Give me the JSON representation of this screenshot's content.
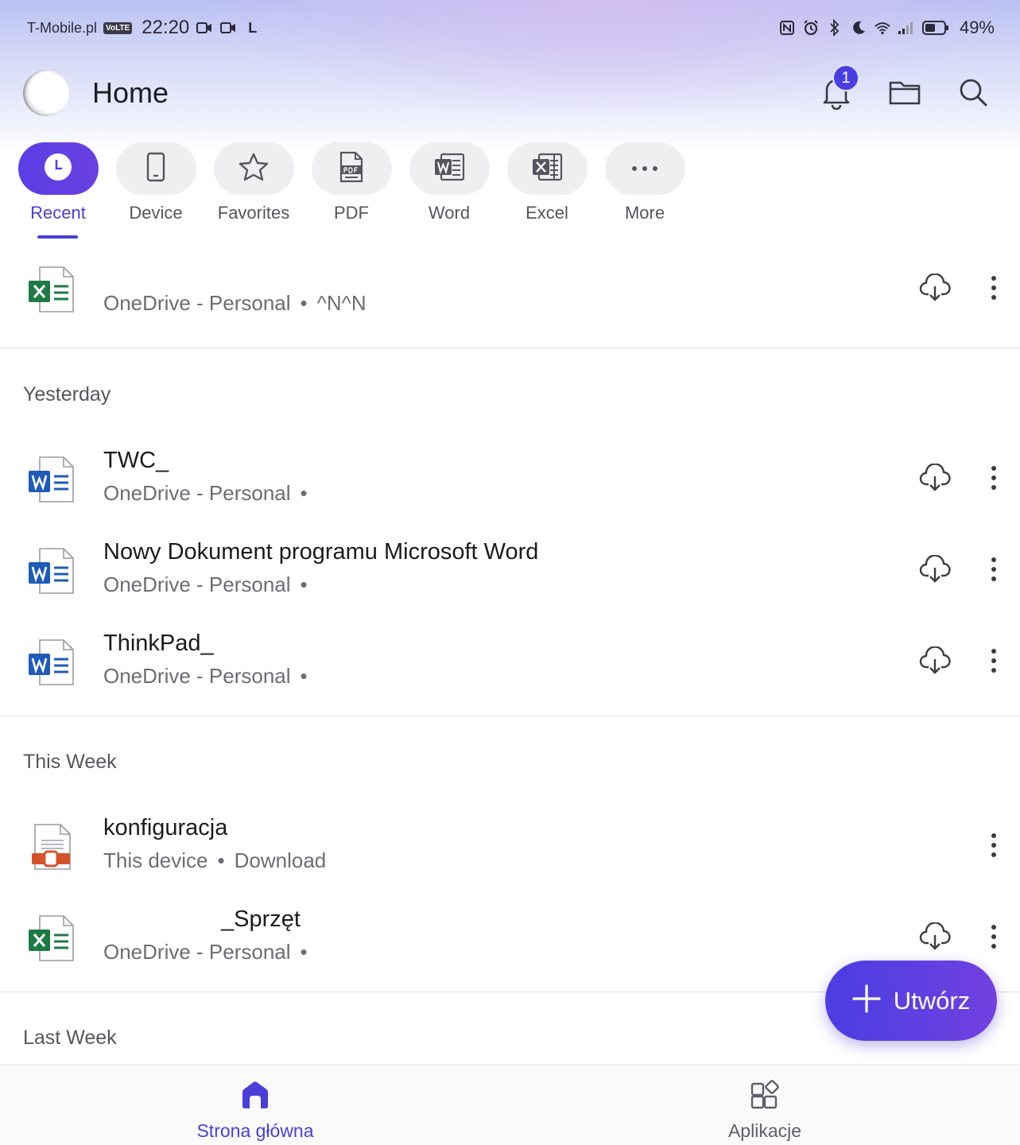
{
  "status_bar": {
    "carrier": "T-Mobile.pl",
    "volte": "VoLTE",
    "time": "22:20",
    "network_letter": "L",
    "battery_percent": "49%"
  },
  "header": {
    "title": "Home",
    "notification_count": "1"
  },
  "categories": [
    {
      "label": "Recent",
      "icon": "clock-icon",
      "active": true
    },
    {
      "label": "Device",
      "icon": "phone-icon"
    },
    {
      "label": "Favorites",
      "icon": "star-icon"
    },
    {
      "label": "PDF",
      "icon": "pdf-icon"
    },
    {
      "label": "Word",
      "icon": "word-icon"
    },
    {
      "label": "Excel",
      "icon": "excel-icon"
    },
    {
      "label": "More",
      "icon": "more-horizontal-icon"
    }
  ],
  "top_file": {
    "name": "",
    "location": "OneDrive - Personal",
    "detail": "^N^N"
  },
  "sections": {
    "yesterday": "Yesterday",
    "this_week": "This Week",
    "last_week": "Last Week"
  },
  "files_yesterday": [
    {
      "name": "TWC_",
      "location": "OneDrive - Personal",
      "type": "word"
    },
    {
      "name": "Nowy Dokument programu Microsoft Word",
      "location": "OneDrive - Personal",
      "type": "word"
    },
    {
      "name": "ThinkPad_",
      "location": "OneDrive - Personal",
      "type": "word"
    }
  ],
  "files_this_week": [
    {
      "name": "konfiguracja",
      "location": "This device",
      "detail": "Download",
      "type": "powerpoint"
    },
    {
      "name": "_Sprzęt",
      "location": "OneDrive - Personal",
      "type": "excel"
    }
  ],
  "fab": {
    "label": "Utwórz"
  },
  "bottom_nav": {
    "home": "Strona główna",
    "apps": "Aplikacje"
  },
  "colors": {
    "accent": "#4a3fd8",
    "excel": "#1e7a45",
    "word": "#1f5bb8",
    "powerpoint": "#d4532d"
  }
}
